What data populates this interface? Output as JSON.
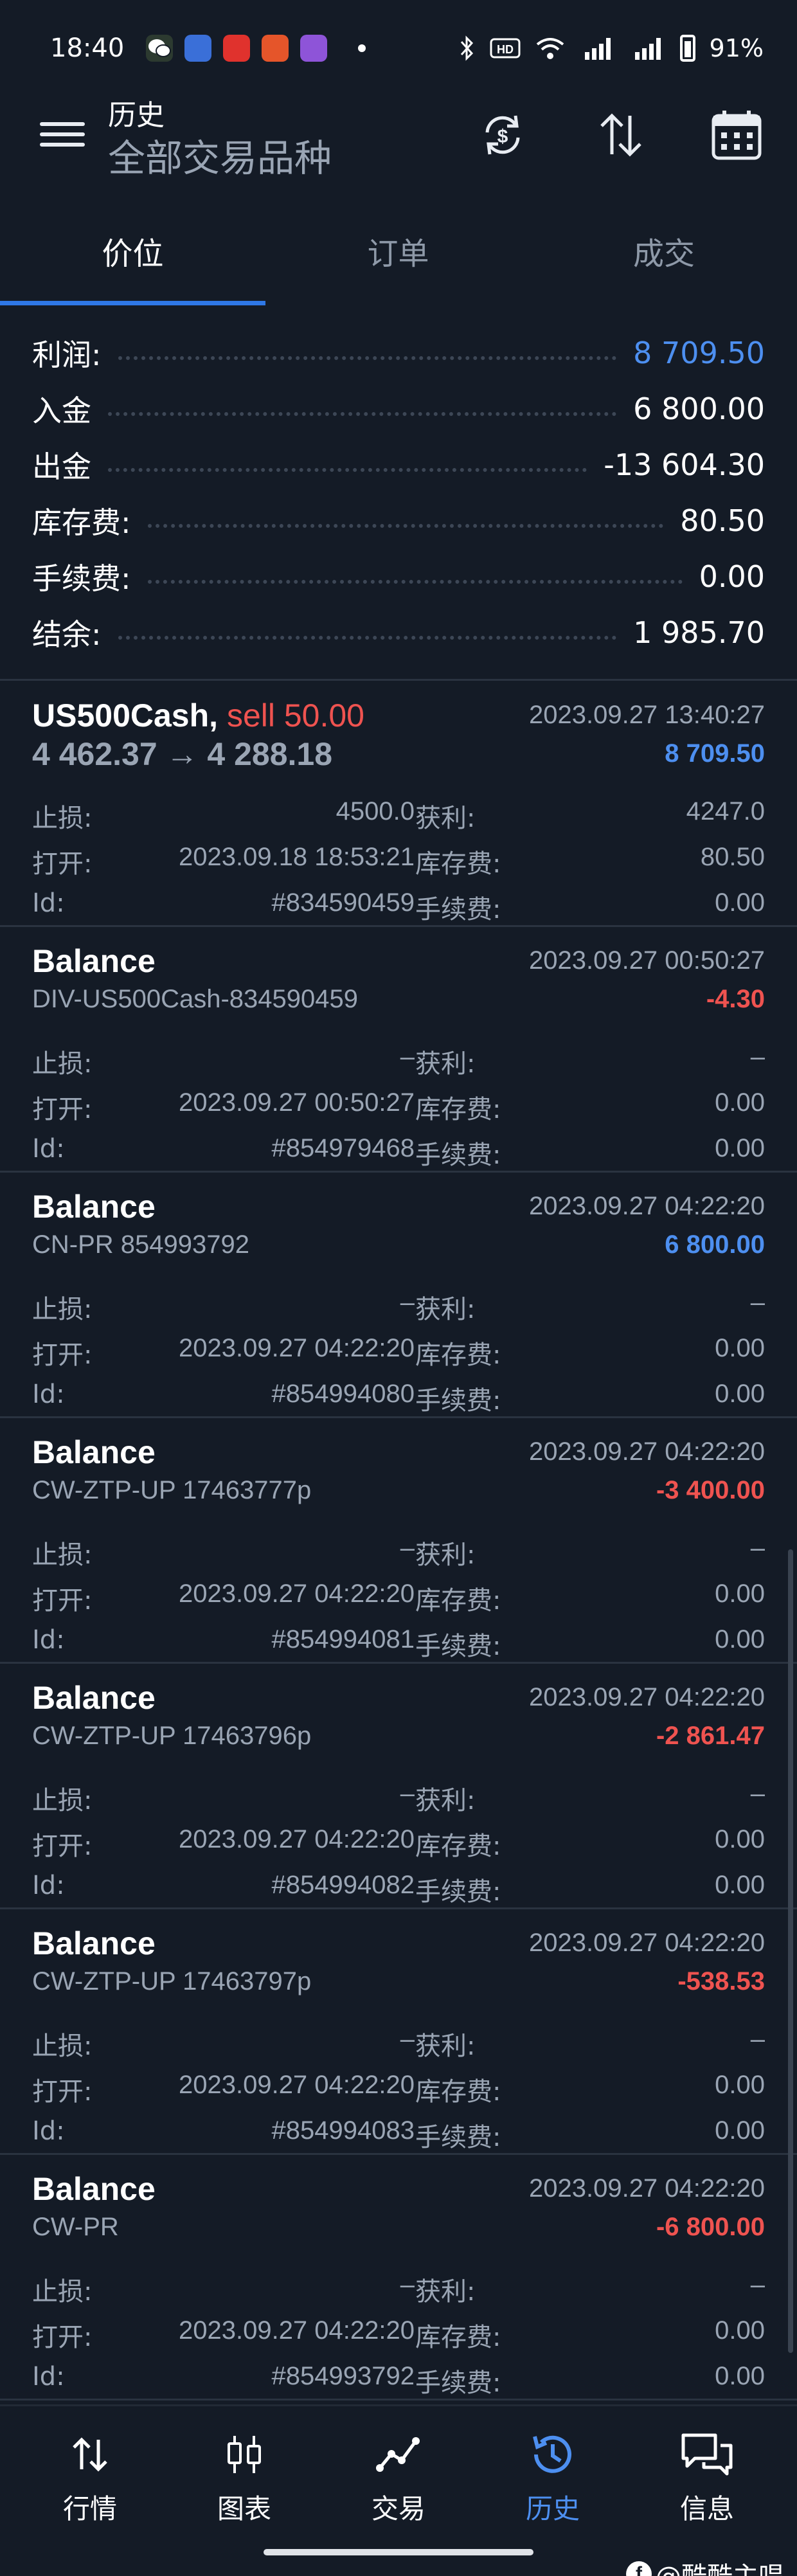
{
  "status_bar": {
    "time": "18:40",
    "battery": "91%"
  },
  "header": {
    "title": "历史",
    "subtitle": "全部交易品种",
    "icons": [
      "sync-dollar-icon",
      "sort-arrows-icon",
      "calendar-icon"
    ]
  },
  "tabs": [
    {
      "label": "价位",
      "active": true
    },
    {
      "label": "订单",
      "active": false
    },
    {
      "label": "成交",
      "active": false
    }
  ],
  "summary": [
    {
      "label": "利润:",
      "value": "8 709.50",
      "highlight": true
    },
    {
      "label": "入金",
      "value": "6 800.00"
    },
    {
      "label": "出金",
      "value": "-13 604.30"
    },
    {
      "label": "库存费:",
      "value": "80.50"
    },
    {
      "label": "手续费:",
      "value": "0.00"
    },
    {
      "label": "结余:",
      "value": "1 985.70"
    }
  ],
  "labels": {
    "stop_loss": "止损:",
    "take_profit": "获利:",
    "open": "打开:",
    "swap": "库存费:",
    "id": "Id:",
    "commission": "手续费:"
  },
  "records": [
    {
      "title": "US500Cash,",
      "side": "sell 50.00",
      "subtitle": "4 462.37 → 4 288.18",
      "date": "2023.09.27 13:40:27",
      "amount": "8 709.50",
      "sign": "pos",
      "stop_loss": "4500.0",
      "take_profit": "4247.0",
      "open": "2023.09.18 18:53:21",
      "swap": "80.50",
      "id": "#834590459",
      "commission": "0.00"
    },
    {
      "title": "Balance",
      "side": "",
      "subtitle": "DIV-US500Cash-834590459",
      "date": "2023.09.27 00:50:27",
      "amount": "-4.30",
      "sign": "neg",
      "stop_loss": "–",
      "take_profit": "–",
      "open": "2023.09.27 00:50:27",
      "swap": "0.00",
      "id": "#854979468",
      "commission": "0.00"
    },
    {
      "title": "Balance",
      "side": "",
      "subtitle": "CN-PR 854993792",
      "date": "2023.09.27 04:22:20",
      "amount": "6 800.00",
      "sign": "pos",
      "stop_loss": "–",
      "take_profit": "–",
      "open": "2023.09.27 04:22:20",
      "swap": "0.00",
      "id": "#854994080",
      "commission": "0.00"
    },
    {
      "title": "Balance",
      "side": "",
      "subtitle": "CW-ZTP-UP 17463777p",
      "date": "2023.09.27 04:22:20",
      "amount": "-3 400.00",
      "sign": "neg",
      "stop_loss": "–",
      "take_profit": "–",
      "open": "2023.09.27 04:22:20",
      "swap": "0.00",
      "id": "#854994081",
      "commission": "0.00"
    },
    {
      "title": "Balance",
      "side": "",
      "subtitle": "CW-ZTP-UP 17463796p",
      "date": "2023.09.27 04:22:20",
      "amount": "-2 861.47",
      "sign": "neg",
      "stop_loss": "–",
      "take_profit": "–",
      "open": "2023.09.27 04:22:20",
      "swap": "0.00",
      "id": "#854994082",
      "commission": "0.00"
    },
    {
      "title": "Balance",
      "side": "",
      "subtitle": "CW-ZTP-UP 17463797p",
      "date": "2023.09.27 04:22:20",
      "amount": "-538.53",
      "sign": "neg",
      "stop_loss": "–",
      "take_profit": "–",
      "open": "2023.09.27 04:22:20",
      "swap": "0.00",
      "id": "#854994083",
      "commission": "0.00"
    },
    {
      "title": "Balance",
      "side": "",
      "subtitle": "CW-PR",
      "date": "2023.09.27 04:22:20",
      "amount": "-6 800.00",
      "sign": "neg",
      "stop_loss": "–",
      "take_profit": "–",
      "open": "2023.09.27 04:22:20",
      "swap": "0.00",
      "id": "#854993792",
      "commission": "0.00"
    }
  ],
  "bottom_nav": [
    {
      "label": "行情",
      "icon": "quotes-arrows-icon",
      "active": false
    },
    {
      "label": "图表",
      "icon": "candlestick-chart-icon",
      "active": false
    },
    {
      "label": "交易",
      "icon": "trade-line-icon",
      "active": false
    },
    {
      "label": "历史",
      "icon": "history-clock-icon",
      "active": true
    },
    {
      "label": "信息",
      "icon": "messages-icon",
      "active": false
    }
  ],
  "watermark": "@酷酷主唱",
  "colors": {
    "background": "#141b26",
    "accent": "#2f78e6",
    "positive": "#4d8ff0",
    "negative": "#ef5350",
    "muted": "#9aa5b4"
  }
}
